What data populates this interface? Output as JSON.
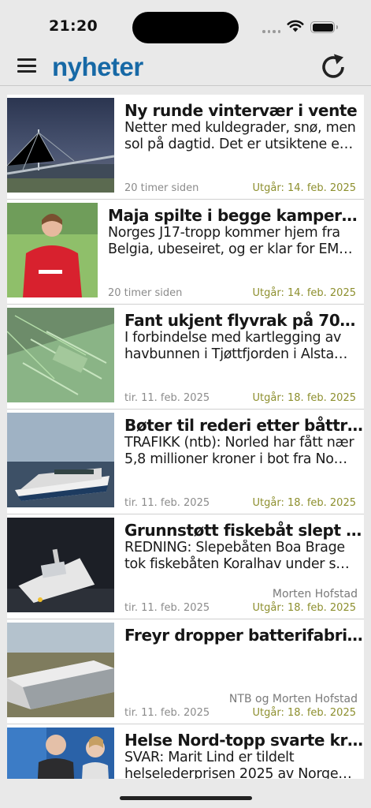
{
  "status": {
    "time": "21:20"
  },
  "app": {
    "title": "nyheter",
    "menu_icon": "hamburger-menu-icon",
    "refresh_icon": "refresh-icon"
  },
  "articles": [
    {
      "title": "Ny runde vintervær i vente",
      "lead": "Netter med kuldegrader, snø, men sol på dagtid. Det er utsiktene e…",
      "author": "",
      "date": "20 timer siden",
      "expires": "Utgår: 14. feb. 2025"
    },
    {
      "title": "Maja spilte i begge kamper…",
      "lead": "Norges J17-tropp kommer hjem fra Belgia, ubeseiret, og er klar for EM…",
      "author": "",
      "date": "20 timer siden",
      "expires": "Utgår: 14. feb. 2025"
    },
    {
      "title": "Fant ukjent flyvrak på 70…",
      "lead": "I forbindelse med kartlegging av havbunnen i Tjøttfjorden i Alsta…",
      "author": "",
      "date": "tir. 11. feb. 2025",
      "expires": "Utgår: 18. feb. 2025"
    },
    {
      "title": "Bøter til rederi etter båttrø…",
      "lead": "TRAFIKK (ntb): Norled har fått nær 5,8 millioner kroner i bot fra No…",
      "author": "",
      "date": "tir. 11. feb. 2025",
      "expires": "Utgår: 18. feb. 2025"
    },
    {
      "title": "Grunnstøtt fiskebåt slept t…",
      "lead": "REDNING: Slepebåten Boa Brage tok fiskebåten Koralhav under s…",
      "author": "Morten Hofstad",
      "date": "tir. 11. feb. 2025",
      "expires": "Utgår: 18. feb. 2025"
    },
    {
      "title": "Freyr dropper batterifabri…",
      "lead": "",
      "author": "NTB og Morten Hofstad",
      "date": "tir. 11. feb. 2025",
      "expires": "Utgår: 18. feb. 2025"
    },
    {
      "title": "Helse Nord-topp svarte kri…",
      "lead": "SVAR: Marit Lind er tildelt helselederprisen 2025 av Norge…",
      "author": "",
      "date": "",
      "expires": ""
    }
  ]
}
